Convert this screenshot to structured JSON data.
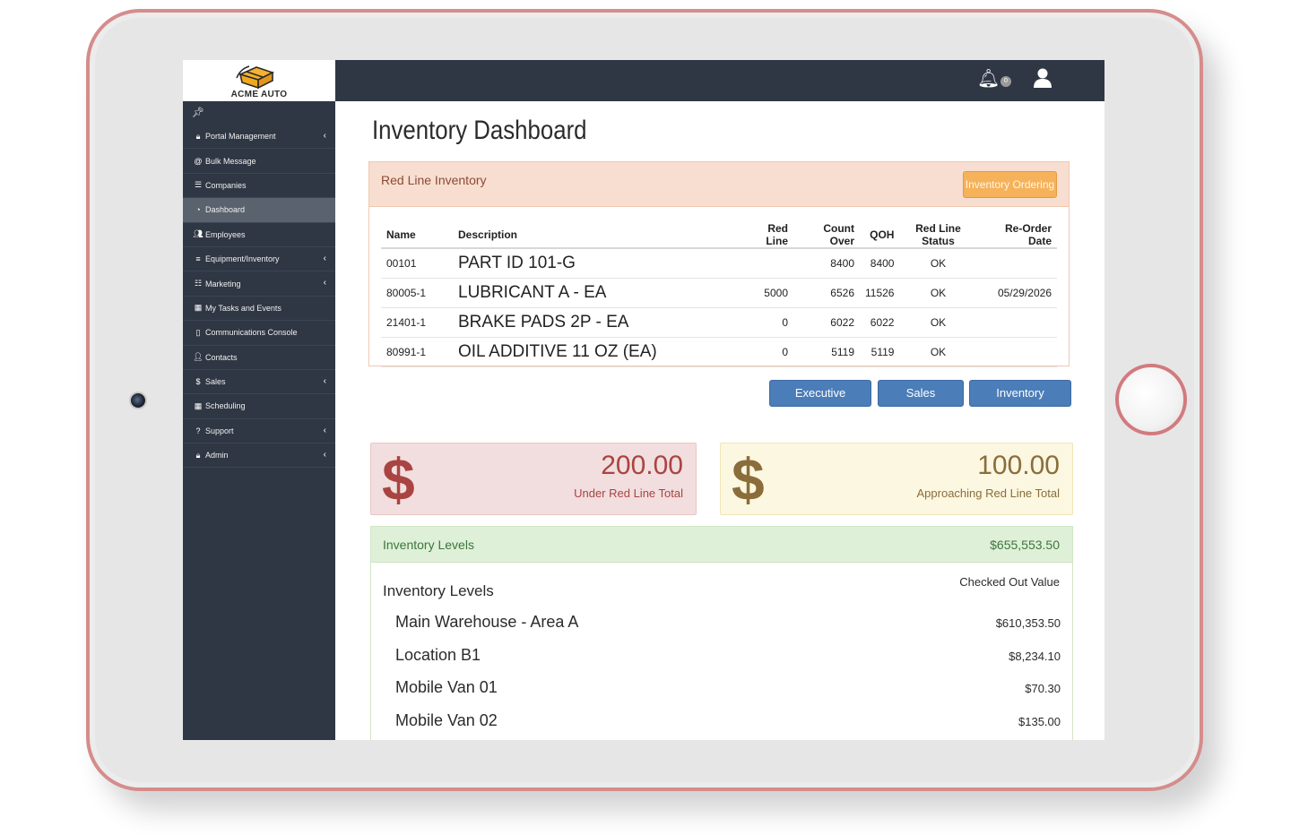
{
  "brand": {
    "name": "ACME AUTO"
  },
  "sidebar": {
    "items": [
      {
        "label": "Portal Management",
        "icon": "lock-icon",
        "chevron": true
      },
      {
        "label": "Bulk Message",
        "icon": "at-icon",
        "chevron": false
      },
      {
        "label": "Companies",
        "icon": "list-icon",
        "chevron": false
      },
      {
        "label": "Dashboard",
        "icon": "dashboard-icon",
        "chevron": false,
        "active": true
      },
      {
        "label": "Employees",
        "icon": "users-icon",
        "chevron": false
      },
      {
        "label": "Equipment/Inventory",
        "icon": "server-icon",
        "chevron": true
      },
      {
        "label": "Marketing",
        "icon": "sitemap-icon",
        "chevron": true
      },
      {
        "label": "My Tasks and Events",
        "icon": "calendar-icon",
        "chevron": false
      },
      {
        "label": "Communications Console",
        "icon": "tablet-icon",
        "chevron": false
      },
      {
        "label": "Contacts",
        "icon": "user-icon",
        "chevron": false
      },
      {
        "label": "Sales",
        "icon": "dollar-icon",
        "chevron": true
      },
      {
        "label": "Scheduling",
        "icon": "calendar-icon",
        "chevron": false
      },
      {
        "label": "Support",
        "icon": "question-icon",
        "chevron": true
      },
      {
        "label": "Admin",
        "icon": "lock-icon",
        "chevron": true
      }
    ]
  },
  "topbar": {
    "notification_count": "0"
  },
  "page": {
    "title": "Inventory Dashboard"
  },
  "red_line": {
    "title": "Red Line Inventory",
    "order_button": "Inventory Ordering",
    "columns": [
      "Name",
      "Description",
      "Red Line",
      "Count Over",
      "QOH",
      "Red Line Status",
      "Re-Order Date"
    ],
    "rows": [
      {
        "name": "00101",
        "description": "PART ID 101-G",
        "red_line": "",
        "count_over": "8400",
        "qoh": "8400",
        "status": "OK",
        "reorder": ""
      },
      {
        "name": "80005-1",
        "description": "LUBRICANT A - EA",
        "red_line": "5000",
        "count_over": "6526",
        "qoh": "11526",
        "status": "OK",
        "reorder": "05/29/2026"
      },
      {
        "name": "21401-1",
        "description": "BRAKE PADS 2P - EA",
        "red_line": "0",
        "count_over": "6022",
        "qoh": "6022",
        "status": "OK",
        "reorder": ""
      },
      {
        "name": "80991-1",
        "description": "OIL ADDITIVE 11 OZ (EA)",
        "red_line": "0",
        "count_over": "5119",
        "qoh": "5119",
        "status": "OK",
        "reorder": ""
      }
    ]
  },
  "tabs": {
    "executive": "Executive",
    "sales": "Sales",
    "inventory": "Inventory"
  },
  "totals": {
    "under": {
      "symbol": "$",
      "amount": "200.00",
      "label": "Under Red Line Total",
      "color": "#a94442"
    },
    "approaching": {
      "symbol": "$",
      "amount": "100.00",
      "label": "Approaching Red Line Total",
      "color": "#8a6d3b"
    }
  },
  "levels": {
    "panel_title": "Inventory Levels",
    "panel_total": "$655,553.50",
    "heading": "Inventory Levels",
    "value_column": "Checked Out Value",
    "rows": [
      {
        "name": "Main Warehouse - Area A",
        "value": "$610,353.50"
      },
      {
        "name": "Location B1",
        "value": "$8,234.10"
      },
      {
        "name": "Mobile Van 01",
        "value": "$70.30"
      },
      {
        "name": "Mobile Van 02",
        "value": "$135.00"
      }
    ]
  }
}
